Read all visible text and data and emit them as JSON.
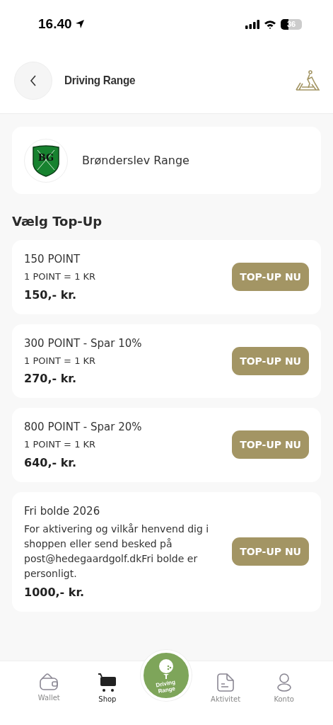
{
  "status_bar": {
    "time": "16.40",
    "battery": "36"
  },
  "header": {
    "title": "Driving Range"
  },
  "club": {
    "logo_text": "BG",
    "name": "Brønderslev Range"
  },
  "section_title": "Vælg Top-Up",
  "offers": [
    {
      "title": "150 POINT",
      "rate": "1 POINT = 1 KR",
      "price": "150,- kr.",
      "button": "TOP-UP NU"
    },
    {
      "title": "300 POINT - Spar 10%",
      "rate": "1 POINT = 1 KR",
      "price": "270,- kr.",
      "button": "TOP-UP NU"
    },
    {
      "title": "800 POINT - Spar 20%",
      "rate": "1 POINT = 1 KR",
      "price": "640,- kr.",
      "button": "TOP-UP NU"
    },
    {
      "title": "Fri bolde 2026",
      "rate": "For aktivering og vilkår henvend dig i shoppen eller send besked på post@hedegaardgolf.dkFri bolde er personligt.",
      "price": "1000,- kr.",
      "button": "TOP-UP NU"
    }
  ],
  "tab_bar": [
    {
      "kind": "wallet",
      "label": "Wallet",
      "selected": false
    },
    {
      "kind": "shop",
      "label": "Shop",
      "selected": true
    },
    {
      "kind": "center",
      "label": "Driving Range",
      "selected": false
    },
    {
      "kind": "activity",
      "label": "Aktivitet",
      "selected": false
    },
    {
      "kind": "account",
      "label": "Konto",
      "selected": false
    }
  ]
}
